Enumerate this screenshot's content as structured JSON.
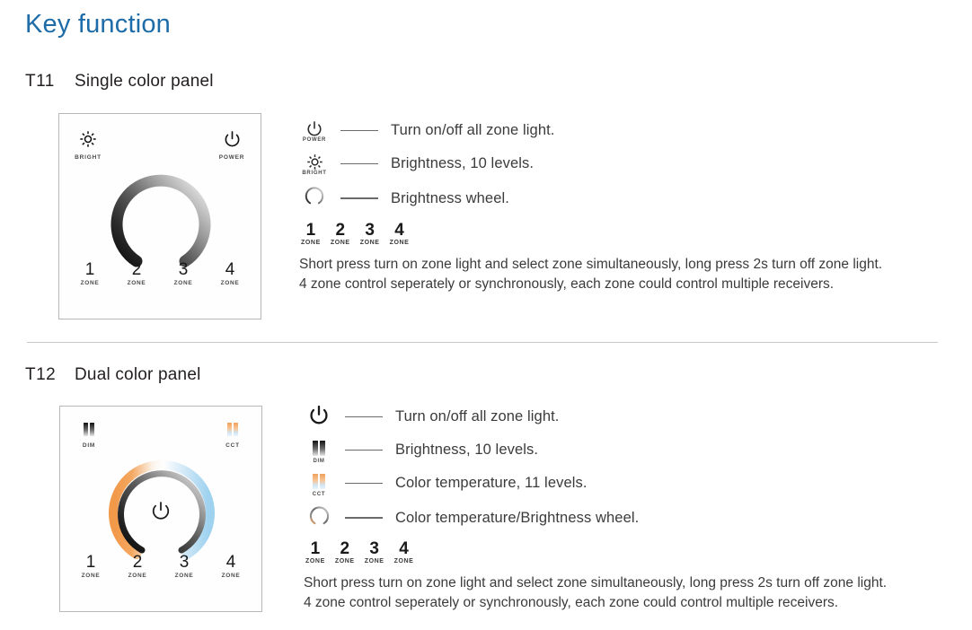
{
  "page": {
    "title": "Key function",
    "title_color": "#1d6ca8"
  },
  "sections": [
    {
      "model": "T11",
      "name": "Single color panel",
      "panel": {
        "top_left_icon": "bright-icon",
        "top_left_label": "BRIGHT",
        "top_right_icon": "power-icon",
        "top_right_label": "POWER",
        "wheel": "brightness-wheel",
        "zones": [
          {
            "num": "1",
            "cap": "ZONE"
          },
          {
            "num": "2",
            "cap": "ZONE"
          },
          {
            "num": "3",
            "cap": "ZONE"
          },
          {
            "num": "4",
            "cap": "ZONE"
          }
        ]
      },
      "legend": [
        {
          "icon": "power-icon",
          "cap": "POWER",
          "text": "Turn on/off all zone light."
        },
        {
          "icon": "bright-icon",
          "cap": "BRIGHT",
          "text": "Brightness, 10 levels."
        },
        {
          "icon": "wheel-icon",
          "cap": "",
          "text": "Brightness wheel."
        }
      ],
      "legend_zones": [
        {
          "num": "1",
          "cap": "ZONE"
        },
        {
          "num": "2",
          "cap": "ZONE"
        },
        {
          "num": "3",
          "cap": "ZONE"
        },
        {
          "num": "4",
          "cap": "ZONE"
        }
      ],
      "note_line1": "Short press turn on zone light and select zone simultaneously, long press 2s turn off zone light.",
      "note_line2": "4 zone control seperately or synchronously, each zone could control multiple receivers."
    },
    {
      "model": "T12",
      "name": "Dual color panel",
      "panel": {
        "top_left_icon": "dim-bars-icon",
        "top_left_label": "DIM",
        "top_right_icon": "cct-bars-icon",
        "top_right_label": "CCT",
        "wheel": "color-temperature-brightness-wheel",
        "center_icon": "power-icon",
        "zones": [
          {
            "num": "1",
            "cap": "ZONE"
          },
          {
            "num": "2",
            "cap": "ZONE"
          },
          {
            "num": "3",
            "cap": "ZONE"
          },
          {
            "num": "4",
            "cap": "ZONE"
          }
        ]
      },
      "legend": [
        {
          "icon": "power-icon",
          "cap": "",
          "text": "Turn on/off all zone light."
        },
        {
          "icon": "dim-bars-icon",
          "cap": "DIM",
          "text": "Brightness, 10 levels."
        },
        {
          "icon": "cct-bars-icon",
          "cap": "CCT",
          "text": "Color temperature, 11 levels."
        },
        {
          "icon": "wheel-icon-color",
          "cap": "",
          "text": "Color temperature/Brightness wheel."
        }
      ],
      "legend_zones": [
        {
          "num": "1",
          "cap": "ZONE"
        },
        {
          "num": "2",
          "cap": "ZONE"
        },
        {
          "num": "3",
          "cap": "ZONE"
        },
        {
          "num": "4",
          "cap": "ZONE"
        }
      ],
      "note_line1": "Short press turn on zone light and select zone simultaneously, long press 2s turn off zone light.",
      "note_line2": "4 zone control seperately or synchronously, each zone could control multiple receivers."
    }
  ],
  "colors": {
    "warm": "#f0a05a",
    "cool": "#a9d6ef",
    "dark": "#151515",
    "light_gray": "#dcdcdc",
    "divider": "#c9c9c9"
  }
}
